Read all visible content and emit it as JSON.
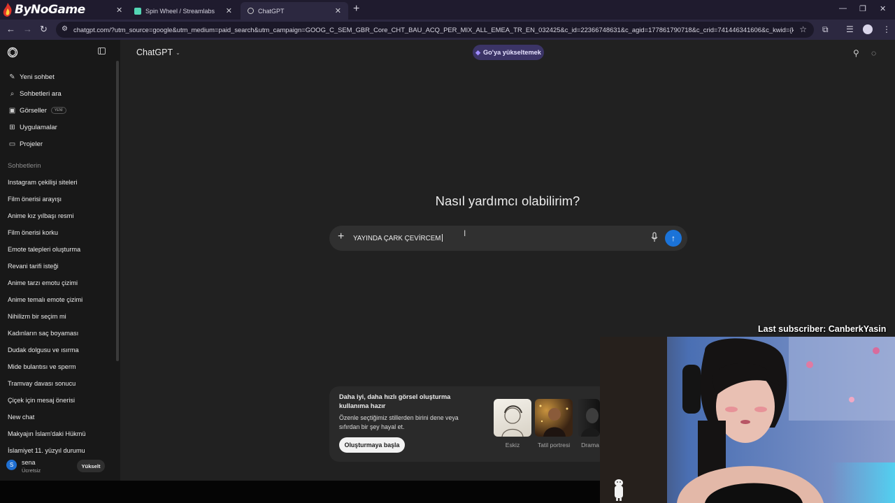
{
  "browser": {
    "brand": "ByNoGame",
    "tabs": [
      {
        "label": "Spin Wheel / Streamlabs",
        "favicon_color": "#53d6b4"
      },
      {
        "label": "ChatGPT",
        "favicon_color": "#cfcfcf"
      }
    ],
    "url": "chatgpt.com/?utm_source=google&utm_medium=paid_search&utm_campaign=GOOG_C_SEM_GBR_Core_CHT_BAU_ACQ_PER_MIX_ALL_EMEA_TR_EN_032425&c_id=22366748631&c_agid=177861790718&c_crid=741446341606&c_kwid={keywordid..."
  },
  "sidebar": {
    "primary_items": [
      {
        "label": "Yeni sohbet",
        "icon": "edit-icon"
      },
      {
        "label": "Sohbetleri ara",
        "icon": "search-icon"
      },
      {
        "label": "Görseller",
        "icon": "image-icon",
        "badge": "YENİ"
      },
      {
        "label": "Uygulamalar",
        "icon": "apps-grid-icon"
      },
      {
        "label": "Projeler",
        "icon": "folder-icon"
      }
    ],
    "section_label": "Sohbetlerin",
    "chats": [
      "Instagram çekilişi siteleri",
      "Film önerisi arayışı",
      "Anime kız yılbaşı resmi",
      "Film önerisi korku",
      "Emote talepleri oluşturma",
      "Revani tarifi isteği",
      "Anime tarzı emotu çizimi",
      "Anime temalı emote çizimi",
      "Nihilizm bir seçim mi",
      "Kadınların saç boyaması",
      "Dudak dolgusu ve ısırma",
      "Mide bulantısı ve sperm",
      "Tramvay davası sonucu",
      "Çiçek için mesaj önerisi",
      "New chat",
      "Makyajın İslam'daki Hükmü",
      "İslamiyet 11. yüzyıl durumu"
    ],
    "user": {
      "initial": "S",
      "name": "sena",
      "plan": "Ücretsiz",
      "upgrade_label": "Yükselt"
    }
  },
  "header": {
    "model": "ChatGPT",
    "upgrade_label": "Go'ya yükseltemek"
  },
  "main": {
    "heading": "Nasıl yardımcı olabilirim?",
    "composer_text": "YAYINDA ÇARK ÇEVİRCEM",
    "promo": {
      "title": "Daha iyi, daha hızlı görsel oluşturma kullanıma hazır",
      "description": "Özenle seçtiğimiz stillerden birini dene veya sıfırdan bir şey hayal et.",
      "button": "Oluşturmaya başla",
      "styles": [
        "Eskiz",
        "Tatil portresi",
        "Drama"
      ]
    }
  },
  "overlay": {
    "last_subscriber": "Last subscriber: CanberkYasin"
  },
  "colors": {
    "accent_blue": "#1b73d8",
    "go_button": "#3b3466",
    "app_bg": "#212121",
    "sidebar_bg": "#181818"
  }
}
